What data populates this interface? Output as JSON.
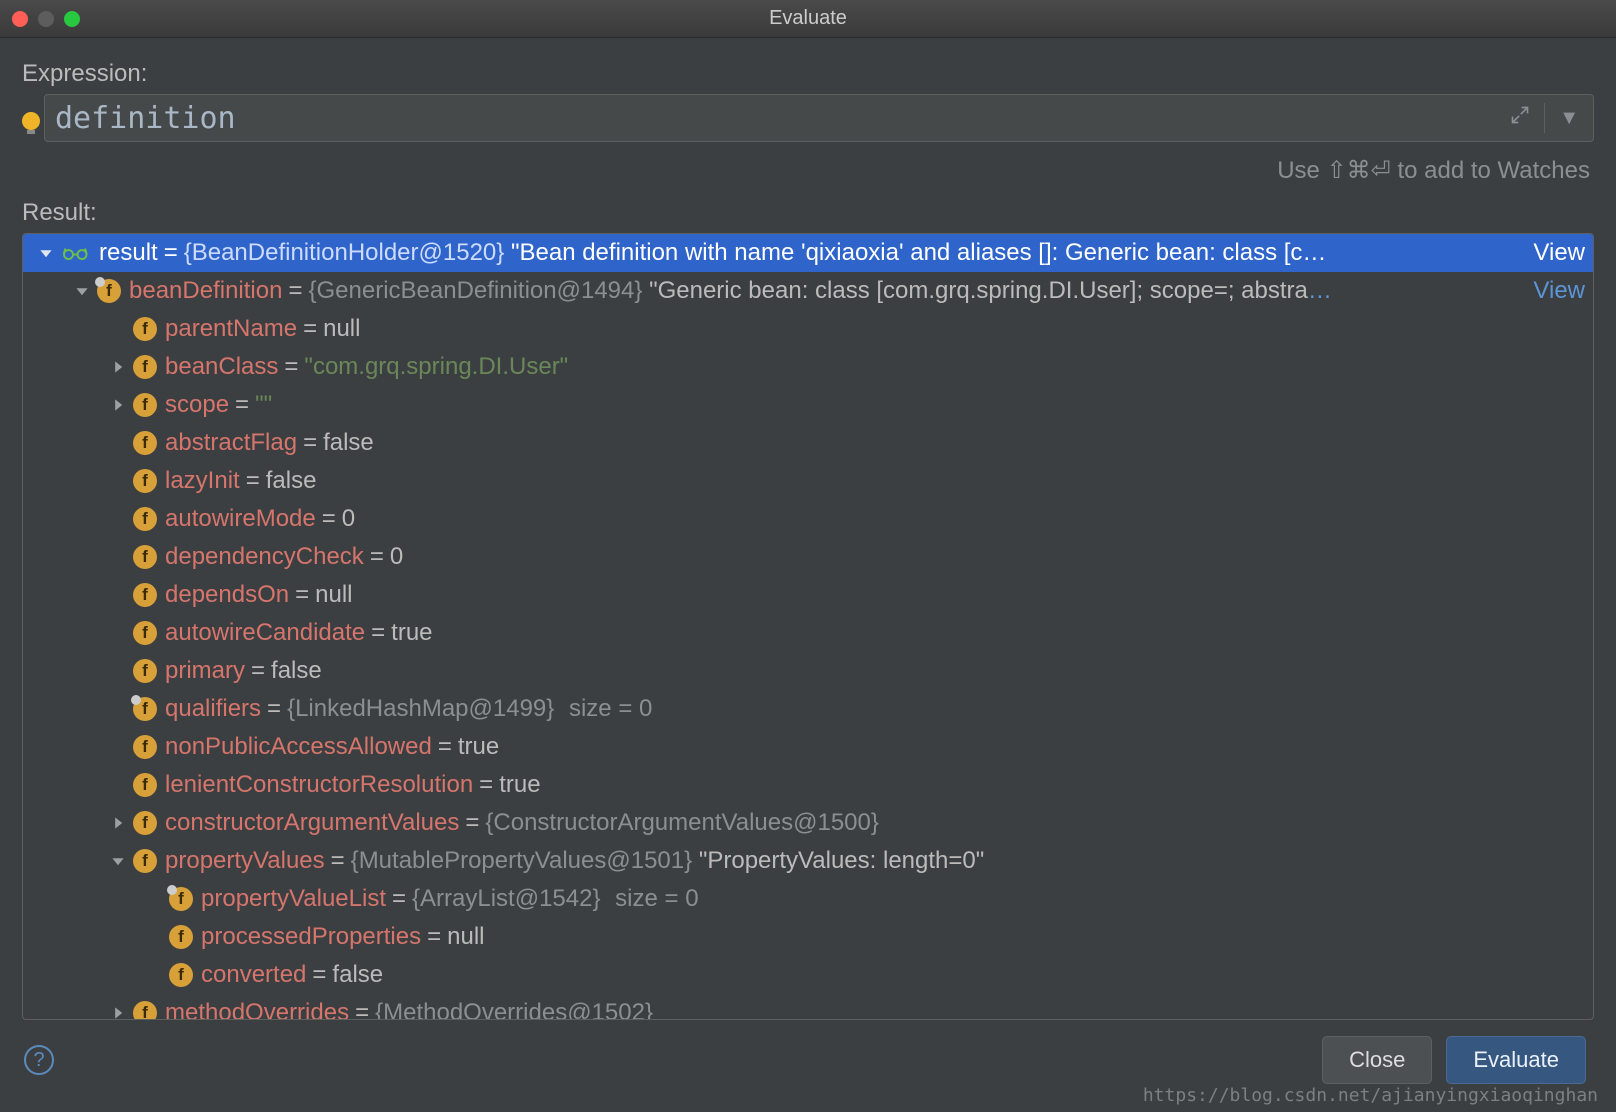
{
  "window": {
    "title": "Evaluate"
  },
  "expression": {
    "label": "Expression:",
    "value": "definition"
  },
  "hint": "Use ⇧⌘⏎ to add to Watches",
  "result_label": "Result:",
  "buttons": {
    "close": "Close",
    "evaluate": "Evaluate"
  },
  "view_link": "View",
  "tree": [
    {
      "depth": 0,
      "disclose": "open",
      "badge": "glasses",
      "selected": true,
      "name": "result",
      "eq": "=",
      "type": "{BeanDefinitionHolder@1520}",
      "val": "\"Bean definition with name 'qixiaoxia' and aliases []: Generic bean: class [c…",
      "view": true
    },
    {
      "depth": 1,
      "disclose": "open",
      "badge": "f",
      "dot": true,
      "name": "beanDefinition",
      "eq": "=",
      "type": "{GenericBeanDefinition@1494}",
      "val": "\"Generic bean: class [com.grq.spring.DI.User]; scope=; abstra",
      "ellipsis": "…",
      "view": true
    },
    {
      "depth": 2,
      "disclose": "none",
      "badge": "f",
      "name": "parentName",
      "eq": "=",
      "val": "null"
    },
    {
      "depth": 2,
      "disclose": "closed",
      "badge": "f",
      "name": "beanClass",
      "eq": "=",
      "val": "\"com.grq.spring.DI.User\"",
      "valClass": "str"
    },
    {
      "depth": 2,
      "disclose": "closed",
      "badge": "f",
      "name": "scope",
      "eq": "=",
      "val": "\"\"",
      "valClass": "str"
    },
    {
      "depth": 2,
      "disclose": "none",
      "badge": "f",
      "name": "abstractFlag",
      "eq": "=",
      "val": "false"
    },
    {
      "depth": 2,
      "disclose": "none",
      "badge": "f",
      "name": "lazyInit",
      "eq": "=",
      "val": "false"
    },
    {
      "depth": 2,
      "disclose": "none",
      "badge": "f",
      "name": "autowireMode",
      "eq": "=",
      "val": "0"
    },
    {
      "depth": 2,
      "disclose": "none",
      "badge": "f",
      "name": "dependencyCheck",
      "eq": "=",
      "val": "0"
    },
    {
      "depth": 2,
      "disclose": "none",
      "badge": "f",
      "name": "dependsOn",
      "eq": "=",
      "val": "null"
    },
    {
      "depth": 2,
      "disclose": "none",
      "badge": "f",
      "name": "autowireCandidate",
      "eq": "=",
      "val": "true"
    },
    {
      "depth": 2,
      "disclose": "none",
      "badge": "f",
      "name": "primary",
      "eq": "=",
      "val": "false"
    },
    {
      "depth": 2,
      "disclose": "none",
      "badge": "f",
      "dot": true,
      "name": "qualifiers",
      "eq": "=",
      "type": "{LinkedHashMap@1499}",
      "trail": " size = 0"
    },
    {
      "depth": 2,
      "disclose": "none",
      "badge": "f",
      "name": "nonPublicAccessAllowed",
      "eq": "=",
      "val": "true"
    },
    {
      "depth": 2,
      "disclose": "none",
      "badge": "f",
      "name": "lenientConstructorResolution",
      "eq": "=",
      "val": "true"
    },
    {
      "depth": 2,
      "disclose": "closed",
      "badge": "f",
      "name": "constructorArgumentValues",
      "eq": "=",
      "type": "{ConstructorArgumentValues@1500}"
    },
    {
      "depth": 2,
      "disclose": "open",
      "badge": "f",
      "name": "propertyValues",
      "eq": "=",
      "type": "{MutablePropertyValues@1501}",
      "val": "\"PropertyValues: length=0\""
    },
    {
      "depth": 3,
      "disclose": "none",
      "badge": "f",
      "dot": true,
      "name": "propertyValueList",
      "eq": "=",
      "type": "{ArrayList@1542}",
      "trail": " size = 0"
    },
    {
      "depth": 3,
      "disclose": "none",
      "badge": "f",
      "name": "processedProperties",
      "eq": "=",
      "val": "null"
    },
    {
      "depth": 3,
      "disclose": "none",
      "badge": "f",
      "name": "converted",
      "eq": "=",
      "val": "false"
    },
    {
      "depth": 2,
      "disclose": "closed",
      "badge": "f",
      "name": "methodOverrides",
      "eq": "=",
      "type": "{MethodOverrides@1502}"
    }
  ],
  "watermark": "https://blog.csdn.net/ajianyingxiaoqinghan"
}
